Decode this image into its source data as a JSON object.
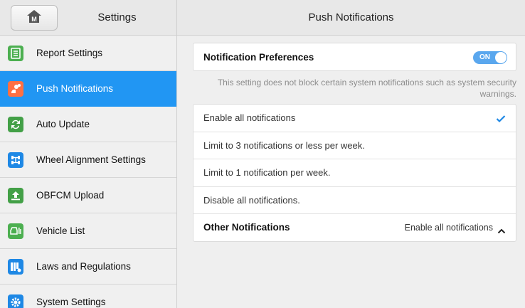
{
  "sidebar": {
    "title": "Settings",
    "home_icon": "home-m-icon",
    "items": [
      {
        "label": "Report Settings",
        "icon": "report-icon",
        "color": "#4caf50",
        "active": false
      },
      {
        "label": "Push Notifications",
        "icon": "push-notification-icon",
        "color": "#ff7043",
        "active": true
      },
      {
        "label": "Auto Update",
        "icon": "auto-update-icon",
        "color": "#43a047",
        "active": false
      },
      {
        "label": "Wheel Alignment Settings",
        "icon": "wheel-alignment-icon",
        "color": "#1e88e5",
        "active": false
      },
      {
        "label": "OBFCM Upload",
        "icon": "upload-icon",
        "color": "#43a047",
        "active": false
      },
      {
        "label": "Vehicle List",
        "icon": "vehicle-list-icon",
        "color": "#4caf50",
        "active": false
      },
      {
        "label": "Laws and Regulations",
        "icon": "laws-icon",
        "color": "#1e88e5",
        "active": false
      },
      {
        "label": "System Settings",
        "icon": "gear-icon",
        "color": "#1e88e5",
        "active": false
      }
    ]
  },
  "main": {
    "title": "Push Notifications",
    "preferences_label": "Notification Preferences",
    "toggle_label": "ON",
    "note": "This setting does not block certain system notifications such as system security warnings.",
    "options": [
      {
        "label": "Enable all notifications",
        "selected": true
      },
      {
        "label": "Limit to 3 notifications or less per week.",
        "selected": false
      },
      {
        "label": "Limit to 1 notification per week.",
        "selected": false
      },
      {
        "label": "Disable all notifications.",
        "selected": false
      }
    ],
    "other_label": "Other Notifications",
    "other_value": "Enable all notifications"
  },
  "colors": {
    "accent": "#2196f3",
    "toggle": "#5aa7ee",
    "check": "#1e88e5"
  }
}
